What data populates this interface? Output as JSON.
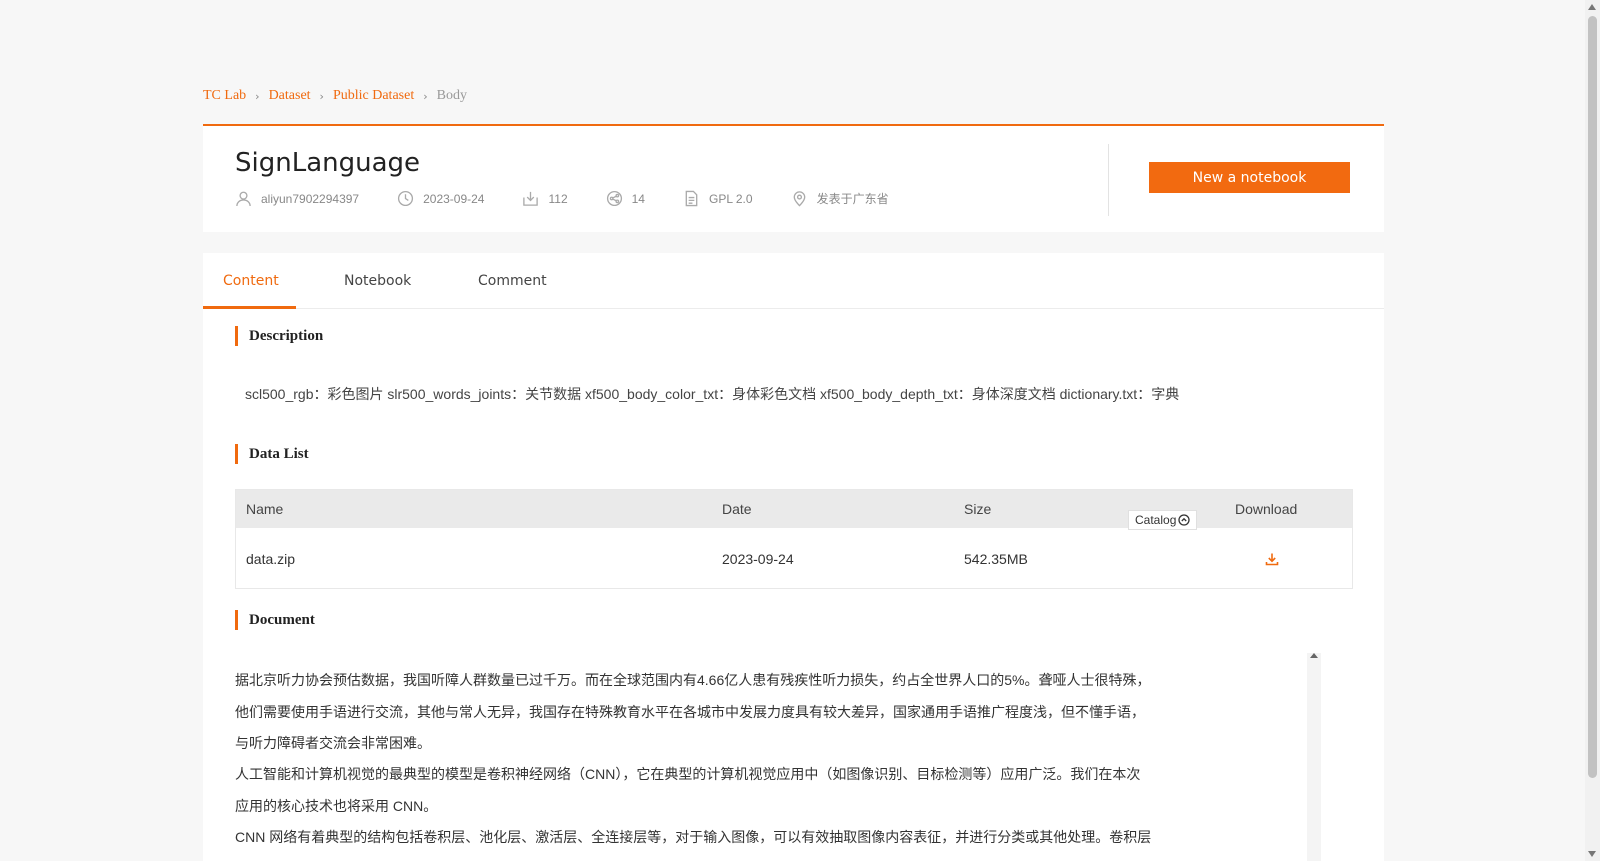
{
  "breadcrumb": {
    "items": [
      "TC Lab",
      "Dataset",
      "Public Dataset"
    ],
    "current": "Body"
  },
  "dataset": {
    "title": "SignLanguage",
    "author": "aliyun7902294397",
    "date": "2023-09-24",
    "downloads": "112",
    "shares": "14",
    "license": "GPL 2.0",
    "location": "发表于广东省",
    "new_notebook_label": "New a notebook"
  },
  "tabs": [
    {
      "label": "Content",
      "active": true
    },
    {
      "label": "Notebook",
      "active": false
    },
    {
      "label": "Comment",
      "active": false
    }
  ],
  "description": {
    "title": "Description",
    "text": "scl500_rgb：彩色图片 slr500_words_joints：关节数据 xf500_body_color_txt：身体彩色文档 xf500_body_depth_txt：身体深度文档 dictionary.txt：字典"
  },
  "data_list": {
    "title": "Data List",
    "columns": [
      "Name",
      "Date",
      "Size",
      "Download"
    ],
    "rows": [
      {
        "name": "data.zip",
        "date": "2023-09-24",
        "size": "542.35MB"
      }
    ]
  },
  "document": {
    "title": "Document",
    "catalog_label": "Catalog",
    "lines": [
      "据北京听力协会预估数据，我国听障人群数量已过千万。而在全球范围内有4.66亿人患有残疾性听力损失，约占全世界人口的5%。聋哑人士很特殊，",
      "他们需要使用手语进行交流，其他与常人无异，我国存在特殊教育水平在各城市中发展力度具有较大差异，国家通用手语推广程度浅，但不懂手语，",
      "与听力障碍者交流会非常困难。",
      "人工智能和计算机视觉的最典型的模型是卷积神经网络（CNN），它在典型的计算机视觉应用中（如图像识别、目标检测等）应用广泛。我们在本次",
      "应用的核心技术也将采用 CNN。",
      "CNN 网络有着典型的结构包括卷积层、池化层、激活层、全连接层等，对于输入图像，可以有效抽取图像内容表征，并进行分类或其他处理。卷积层"
    ]
  },
  "colors": {
    "accent": "#f06a0f",
    "background": "#f7f7f7"
  }
}
